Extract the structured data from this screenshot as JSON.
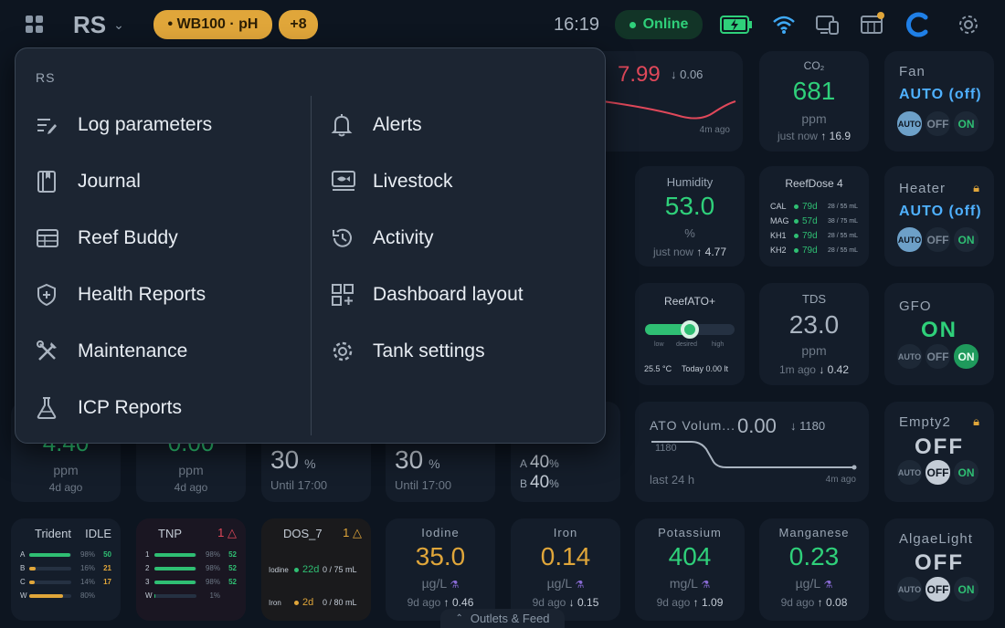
{
  "header": {
    "site": "RS",
    "tank_pill": "• WB100 · pH",
    "more_pill": "+8",
    "time": "16:19",
    "status": "Online",
    "colors": {
      "accent": "#e0a63a",
      "online": "#2fd07a",
      "bg": "#0d1520"
    }
  },
  "menu": {
    "title": "RS",
    "left": [
      {
        "label": "Log parameters",
        "icon": "log-icon"
      },
      {
        "label": "Journal",
        "icon": "book-icon"
      },
      {
        "label": "Reef Buddy",
        "icon": "calendar-icon"
      },
      {
        "label": "Health Reports",
        "icon": "shield-icon"
      },
      {
        "label": "Maintenance",
        "icon": "tools-icon"
      },
      {
        "label": "ICP Reports",
        "icon": "flask-icon"
      }
    ],
    "right": [
      {
        "label": "Alerts",
        "icon": "bell-icon"
      },
      {
        "label": "Livestock",
        "icon": "fish-icon"
      },
      {
        "label": "Activity",
        "icon": "history-icon"
      },
      {
        "label": "Dashboard layout",
        "icon": "grid-plus-icon"
      },
      {
        "label": "Tank settings",
        "icon": "gear-icon"
      }
    ]
  },
  "cards": {
    "ph": {
      "value": "7.99",
      "delta": "↓ 0.06",
      "ago": "4m ago"
    },
    "co2": {
      "title": "CO₂",
      "value": "681",
      "unit": "ppm",
      "ago": "just now",
      "delta": "↑ 16.9"
    },
    "fan": {
      "title": "Fan",
      "state": "AUTO (off)",
      "auto": "AUTO",
      "off": "OFF",
      "on": "ON"
    },
    "humidity": {
      "title": "Humidity",
      "value": "53.0",
      "unit": "%",
      "ago": "just now",
      "delta": "↑ 4.77"
    },
    "reefdose": {
      "title": "ReefDose 4",
      "rows": [
        {
          "name": "CAL",
          "days": "79d",
          "vol": "28 / 55 mL"
        },
        {
          "name": "MAG",
          "days": "57d",
          "vol": "38 / 75 mL"
        },
        {
          "name": "KH1",
          "days": "79d",
          "vol": "28 / 55 mL"
        },
        {
          "name": "KH2",
          "days": "79d",
          "vol": "28 / 55 mL"
        }
      ]
    },
    "heater": {
      "title": "Heater",
      "state": "AUTO (off)",
      "auto": "AUTO",
      "off": "OFF",
      "on": "ON"
    },
    "reefato": {
      "title": "ReefATO+",
      "low": "low",
      "desired": "desired",
      "high": "high",
      "temp": "25.5 °C",
      "today": "Today 0.00 lt",
      "level": 0.5
    },
    "tds": {
      "title": "TDS",
      "value": "23.0",
      "unit": "ppm",
      "ago": "1m ago",
      "delta": "↓ 0.42"
    },
    "gfo": {
      "title": "GFO",
      "state": "ON",
      "auto": "AUTO",
      "off": "OFF",
      "on": "ON"
    },
    "row4a": {
      "value": "4.40",
      "unit": "ppm",
      "ago": "4d ago"
    },
    "row4b": {
      "value": "0.00",
      "unit": "ppm",
      "ago": "4d ago"
    },
    "light1": {
      "value": "30",
      "unit": "%",
      "until": "Until 17:00"
    },
    "light2": {
      "value": "30",
      "unit": "%",
      "until": "Until 17:00"
    },
    "ab": {
      "a_label": "A",
      "a_value": "40",
      "b_label": "B",
      "b_value": "40",
      "unit": "%"
    },
    "atovol": {
      "title": "ATO Volum...",
      "value": "0.00",
      "delta": "↓ 1180",
      "axis": "1180",
      "range": "last 24 h",
      "ago": "4m ago"
    },
    "empty2": {
      "title": "Empty2",
      "state": "OFF",
      "auto": "AUTO",
      "off": "OFF",
      "on": "ON"
    },
    "trident": {
      "title": "Trident",
      "status": "IDLE",
      "rows": [
        {
          "n": "A",
          "pct": "98%",
          "v": "50",
          "fill": 0.98,
          "c": "#2fbf73"
        },
        {
          "n": "B",
          "pct": "16%",
          "v": "21",
          "fill": 0.16,
          "c": "#e0a63a"
        },
        {
          "n": "C",
          "pct": "14%",
          "v": "17",
          "fill": 0.14,
          "c": "#e0a63a"
        },
        {
          "n": "W",
          "pct": "80%",
          "v": "",
          "fill": 0.8,
          "c": "#e0a63a"
        }
      ]
    },
    "tnp": {
      "title": "TNP",
      "alert": "1",
      "rows": [
        {
          "n": "1",
          "pct": "98%",
          "v": "52",
          "fill": 0.98
        },
        {
          "n": "2",
          "pct": "98%",
          "v": "52",
          "fill": 0.98
        },
        {
          "n": "3",
          "pct": "98%",
          "v": "52",
          "fill": 0.98
        },
        {
          "n": "W",
          "pct": "1%",
          "v": "",
          "fill": 0.01
        }
      ]
    },
    "dos7": {
      "title": "DOS_7",
      "alert": "1",
      "rows": [
        {
          "name": "Iodine",
          "days": "22d",
          "vol": "0 / 75 mL",
          "c": "#2fbf73"
        },
        {
          "name": "Iron",
          "days": "2d",
          "vol": "0 / 80 mL",
          "c": "#e0a63a"
        }
      ]
    },
    "iodine": {
      "title": "Iodine",
      "value": "35.0",
      "unit": "µg/L",
      "ago": "9d ago",
      "delta": "↑ 0.46"
    },
    "iron": {
      "title": "Iron",
      "value": "0.14",
      "unit": "µg/L",
      "ago": "9d ago",
      "delta": "↓ 0.15"
    },
    "potassium": {
      "title": "Potassium",
      "value": "404",
      "unit": "mg/L",
      "ago": "9d ago",
      "delta": "↑ 1.09"
    },
    "manganese": {
      "title": "Manganese",
      "value": "0.23",
      "unit": "µg/L",
      "ago": "9d ago",
      "delta": "↑ 0.08"
    },
    "algae": {
      "title": "AlgaeLight",
      "state": "OFF",
      "auto": "AUTO",
      "off": "OFF",
      "on": "ON"
    }
  },
  "footer": {
    "label": "Outlets & Feed"
  }
}
